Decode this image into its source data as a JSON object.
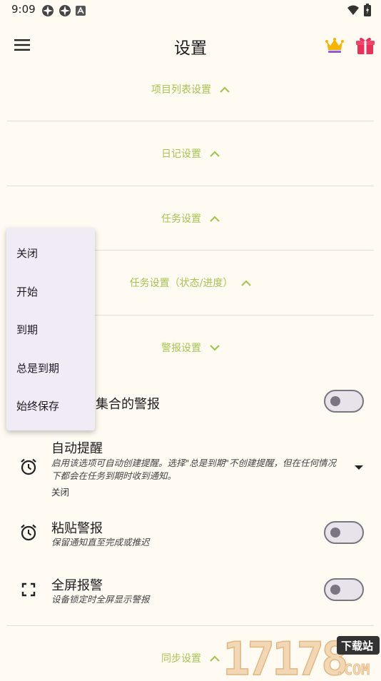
{
  "status_bar": {
    "time": "9:09"
  },
  "app_bar": {
    "title": "设置"
  },
  "sections": {
    "project_list": "项目列表设置",
    "diary": "日记设置",
    "task": "任务设置",
    "task_status": "任务设置（状态/进度）",
    "alert": "警报设置",
    "sync": "同步设置"
  },
  "alert_rows": {
    "collection_alert": {
      "title_fragment": "续集合的警报"
    },
    "auto_remind": {
      "title": "自动提醒",
      "subtitle": "启用该选项可自动创建提醒。选择\"总是到期\"不创建提醒，但在任何情况下都会在任务到期时收到通知。",
      "value": "关闭"
    },
    "sticky_alert": {
      "title": "粘贴警报",
      "subtitle": "保留通知直至完成或推迟"
    },
    "fullscreen_alert": {
      "title": "全屏报警",
      "subtitle": "设备锁定时全屏显示警报"
    }
  },
  "popup_menu": {
    "options": [
      "关闭",
      "开始",
      "到期",
      "总是到期",
      "始终保存"
    ]
  },
  "watermark": {
    "text": "17178",
    "sub": "下载站",
    "domain": ".COM"
  },
  "colors": {
    "background": "#fffbf3",
    "accent": "#a8c255",
    "popup": "#f1ebf6"
  },
  "icons": {
    "menu": "hamburger-menu-icon",
    "crown": "crown-icon",
    "gift": "gift-icon",
    "alarm": "alarm-clock-icon",
    "fullscreen": "fullscreen-icon",
    "chevron_up": "chevron-up-icon",
    "chevron_down": "chevron-down-icon"
  }
}
